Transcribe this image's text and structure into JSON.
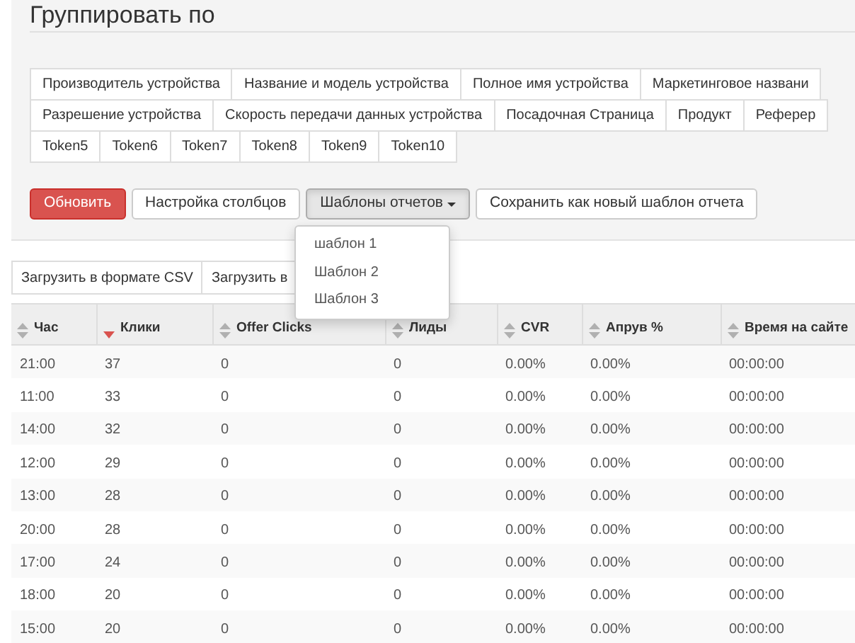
{
  "title": "Группировать по",
  "group_rows": [
    [
      "Производитель устройства",
      "Название и модель устройства",
      "Полное имя устройства",
      "Маркетинговое названи"
    ],
    [
      "Разрешение устройства",
      "Скорость передачи данных устройства",
      "Посадочная Страница",
      "Продукт",
      "Реферер"
    ],
    [
      "Token5",
      "Token6",
      "Token7",
      "Token8",
      "Token9",
      "Token10"
    ]
  ],
  "actions": [
    {
      "label": "Обновить",
      "kind": "primary"
    },
    {
      "label": "Настройка столбцов",
      "kind": "default"
    },
    {
      "label": "Шаблоны отчетов",
      "kind": "dropdown"
    },
    {
      "label": "Сохранить как новый шаблон отчета",
      "kind": "default"
    }
  ],
  "template_menu": [
    "шаблон 1",
    "Шаблон 2",
    "Шаблон 3"
  ],
  "downloads": [
    "Загрузить в формате CSV",
    "Загрузить в"
  ],
  "table": {
    "columns": [
      {
        "label": "Час",
        "sorted_desc": false
      },
      {
        "label": "Клики",
        "sorted_desc": true
      },
      {
        "label": "Offer Clicks",
        "sorted_desc": false
      },
      {
        "label": "Лиды",
        "sorted_desc": false
      },
      {
        "label": "CVR",
        "sorted_desc": false
      },
      {
        "label": "Апрув %",
        "sorted_desc": false
      },
      {
        "label": "Время на сайте",
        "sorted_desc": false
      }
    ],
    "rows": [
      [
        "21:00",
        "37",
        "0",
        "0",
        "0.00%",
        "0.00%",
        "00:00:00"
      ],
      [
        "11:00",
        "33",
        "0",
        "0",
        "0.00%",
        "0.00%",
        "00:00:00"
      ],
      [
        "14:00",
        "32",
        "0",
        "0",
        "0.00%",
        "0.00%",
        "00:00:00"
      ],
      [
        "12:00",
        "29",
        "0",
        "0",
        "0.00%",
        "0.00%",
        "00:00:00"
      ],
      [
        "13:00",
        "28",
        "0",
        "0",
        "0.00%",
        "0.00%",
        "00:00:00"
      ],
      [
        "20:00",
        "28",
        "0",
        "0",
        "0.00%",
        "0.00%",
        "00:00:00"
      ],
      [
        "17:00",
        "24",
        "0",
        "0",
        "0.00%",
        "0.00%",
        "00:00:00"
      ],
      [
        "18:00",
        "20",
        "0",
        "0",
        "0.00%",
        "0.00%",
        "00:00:00"
      ],
      [
        "15:00",
        "20",
        "0",
        "0",
        "0.00%",
        "0.00%",
        "00:00:00"
      ]
    ]
  }
}
